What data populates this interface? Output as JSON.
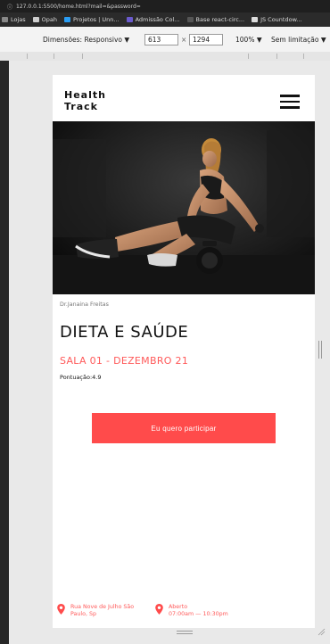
{
  "browser": {
    "url": "127.0.0.1:5500/home.html?mail=&password=",
    "bookmarks": [
      "Lojas",
      "Opah",
      "Projetos | Unn...",
      "Admissão Col...",
      "Base react-circ...",
      "JS Countdow..."
    ]
  },
  "devtools": {
    "dimensions_label": "Dimensões: Responsivo ▼",
    "width_value": "613",
    "separator": "×",
    "height_value": "1294",
    "zoom": "100% ▼",
    "throttle": "Sem limitação ▼"
  },
  "header": {
    "logo_line1": "Health",
    "logo_line2": "Track"
  },
  "event": {
    "author": "Dr.Janaina Freitas",
    "title": "DIETA E SAÚDE",
    "session": "SALA 01 - DEZEMBRO 21",
    "score": "Pontuação:4.9",
    "cta_label": "Eu quero participar"
  },
  "footer": {
    "address_line1": "Rua Nove de Julho São",
    "address_line2": "Paulo, Sp",
    "hours_line1": "Aberto",
    "hours_line2": "07:00am — 10:30pm"
  },
  "colors": {
    "accent": "#ff4b4b"
  }
}
